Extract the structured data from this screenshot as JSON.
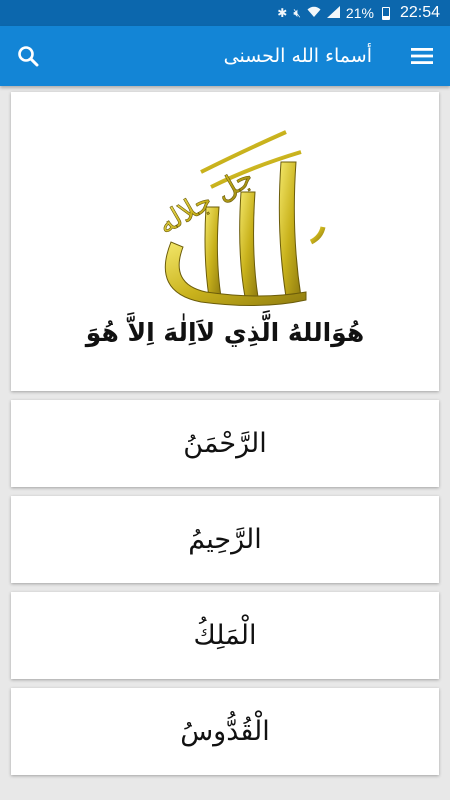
{
  "status_bar": {
    "battery_percent": "21%",
    "time": "22:54"
  },
  "app_bar": {
    "title": "أسماء الله الحسنى",
    "menu_icon": "menu-icon",
    "search_icon": "search-icon"
  },
  "hero": {
    "calligraphy_text": "الله",
    "verse": "هُوَاللهُ الَّذِي لاَاِلٰهَ اِلاَّ هُوَ"
  },
  "names": [
    {
      "label": "الرَّحْمَنُ"
    },
    {
      "label": "الرَّحِيمُ"
    },
    {
      "label": "الْمَلِكُ"
    },
    {
      "label": "الْقُدُّوسُ"
    }
  ],
  "colors": {
    "status_bar": "#0c67ad",
    "app_bar": "#1385d6",
    "background": "#e8e8e8",
    "gold": "#c9b21c"
  }
}
